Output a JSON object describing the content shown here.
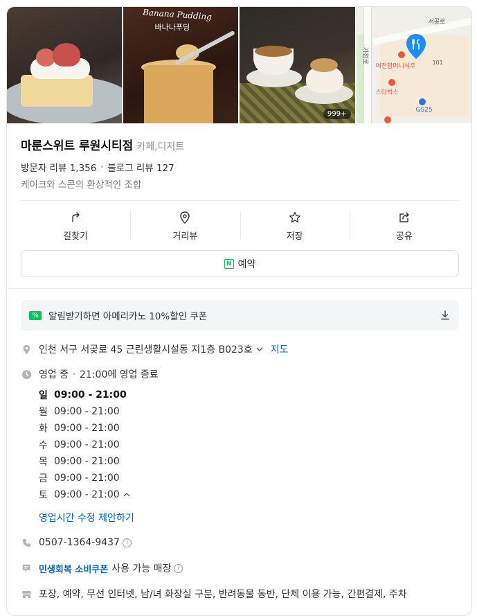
{
  "photos": {
    "photo2_caption_en": "Banana Pudding",
    "photo2_caption_ko": "바나나푸딩",
    "photo3_count_badge": "999+",
    "map": {
      "road_top": "서곶로",
      "road_side": "가정로",
      "place_1": "여전함머니식주",
      "place_1_num": "101",
      "place_2": "스타벅스",
      "place_3": "GS25"
    }
  },
  "place": {
    "name": "마룬스위트 루원시티점",
    "category": "카페,디저트",
    "visitor_reviews_label": "방문자 리뷰",
    "visitor_reviews_count": "1,356",
    "blog_reviews_label": "블로그 리뷰",
    "blog_reviews_count": "127",
    "description": "케이크와 스콘의 환상적인 조합"
  },
  "actions": [
    {
      "label": "길찾기",
      "icon": "directions-icon"
    },
    {
      "label": "거리뷰",
      "icon": "location-pin-icon"
    },
    {
      "label": "저장",
      "icon": "star-icon"
    },
    {
      "label": "공유",
      "icon": "share-icon"
    }
  ],
  "reserve_label": "예약",
  "coupon_text": "알림받기하면 아메리카노 10%할인 쿠폰",
  "address": {
    "text": "인천 서구 서곶로 45 근린생활시설동 지1층 B023호",
    "map_link": "지도"
  },
  "status": {
    "state": "영업 중",
    "detail": "21:00에 영업 종료"
  },
  "hours": [
    {
      "day": "일",
      "time": "09:00 - 21:00",
      "today": true
    },
    {
      "day": "월",
      "time": "09:00 - 21:00",
      "today": false
    },
    {
      "day": "화",
      "time": "09:00 - 21:00",
      "today": false
    },
    {
      "day": "수",
      "time": "09:00 - 21:00",
      "today": false
    },
    {
      "day": "목",
      "time": "09:00 - 21:00",
      "today": false
    },
    {
      "day": "금",
      "time": "09:00 - 21:00",
      "today": false
    },
    {
      "day": "토",
      "time": "09:00 - 21:00",
      "today": false
    }
  ],
  "hours_suggest_link": "영업시간 수정 제안하기",
  "phone": "0507-1364-9437",
  "coupon_program": {
    "name": "민생회복 소비쿠폰",
    "suffix": "사용 가능 매장"
  },
  "amenities": "포장, 예약, 무선 인터넷, 남/녀 화장실 구분, 반려동물 동반, 단체 이용 가능, 간편결제, 주차",
  "colors": {
    "accent_green": "#03c75a",
    "link_blue": "#0068c3",
    "pin_blue": "#1a8cff"
  }
}
